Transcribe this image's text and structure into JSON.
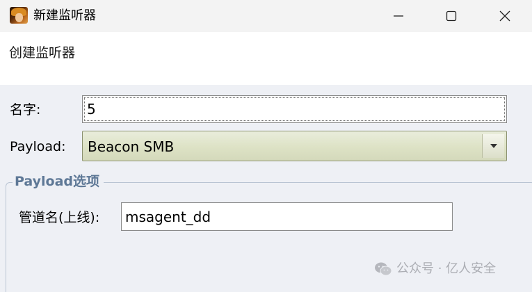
{
  "window": {
    "title": "新建监听器",
    "icon": "app-character-icon",
    "controls": [
      "minimize-icon",
      "maximize-icon",
      "close-icon"
    ]
  },
  "header": {
    "text": "创建监听器"
  },
  "form": {
    "name_label": "名字:",
    "name_value": "5",
    "payload_label": "Payload:",
    "payload_value": "Beacon SMB"
  },
  "payload_options": {
    "group_title": "Payload选项",
    "pipe_label": "管道名(上线):",
    "pipe_value": "msagent_dd"
  },
  "watermark": {
    "text": "公众号 · 亿人安全"
  },
  "colors": {
    "titlebar": "#f3f3f3",
    "background": "#eef0f5",
    "banner": "#ffffff",
    "select_bg": "#dde2c5",
    "group_title": "#5e7896",
    "group_border": "#b9c4d3"
  }
}
